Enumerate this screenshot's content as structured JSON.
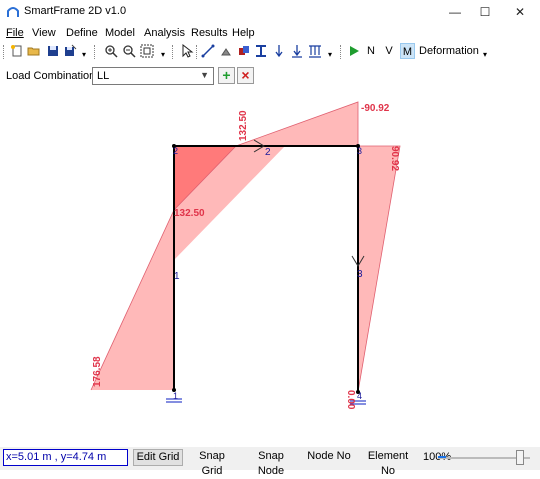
{
  "window": {
    "title": "SmartFrame 2D v1.0",
    "controls": {
      "minimize": "—",
      "maximize": "☐",
      "close": "✕"
    }
  },
  "menu": [
    "File",
    "View",
    "Define",
    "Model",
    "Analysis",
    "Results",
    "Help"
  ],
  "toolbar": {
    "n_label": "N",
    "v_label": "V",
    "m_label": "M",
    "deformation_label": "Deformation",
    "active_result": "M"
  },
  "load_combination": {
    "label": "Load Combination",
    "value": "LL",
    "add_symbol": "+",
    "remove_symbol": "×"
  },
  "diagram": {
    "nodes": [
      "1",
      "2",
      "3",
      "4"
    ],
    "elements": [
      "1",
      "2",
      "3"
    ],
    "moment_labels": [
      "132.50",
      "-90.92",
      "132.50",
      "90.92",
      "176.58",
      "0.00"
    ]
  },
  "colors": {
    "moment_fill": "#ff8080",
    "moment_dark": "#ff6060",
    "moment_text": "#e0344a",
    "frame": "#000000",
    "node_label": "#1a1a9a",
    "support": "#3344cc",
    "accent": "#cce4f7"
  },
  "status": {
    "coords": "x=5.01 m , y=4.74 m",
    "edit_grid": "Edit Grid",
    "snap_grid": "Snap Grid",
    "snap_node": "Snap Node",
    "node_no": "Node No",
    "element_no": "Element No",
    "zoom": "100%",
    "zoom_level": 1.0
  }
}
